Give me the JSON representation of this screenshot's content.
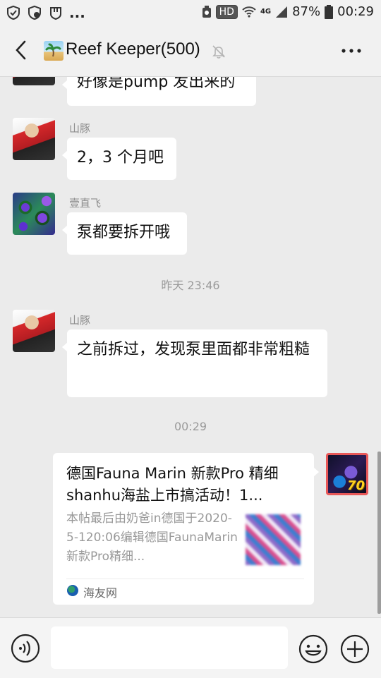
{
  "status_bar": {
    "dots": "...",
    "hd": "HD",
    "network": "4G",
    "battery": "87%",
    "time": "00:29"
  },
  "header": {
    "title": "Reef Keeper(500)"
  },
  "messages": [
    {
      "sender": "",
      "text": "好像是pump 发出来的"
    },
    {
      "sender": "山豚",
      "text": "2，3 个月吧"
    },
    {
      "sender": "壹直飞",
      "text": "泵都要拆开哦"
    },
    {
      "type": "time",
      "text": "昨天 23:46"
    },
    {
      "sender": "山豚",
      "text": "之前拆过，发现泵里面都非常粗糙"
    },
    {
      "type": "time",
      "text": "00:29"
    }
  ],
  "card": {
    "title": "德国Fauna Marin 新款Pro 精细shanhu海盐上市搞活动！1...",
    "desc": "本帖最后由奶爸in德国于2020-5-120:06编辑德国FaunaMarin新款Pro精细...",
    "source": "海友网"
  },
  "my_avatar_badge": "70"
}
